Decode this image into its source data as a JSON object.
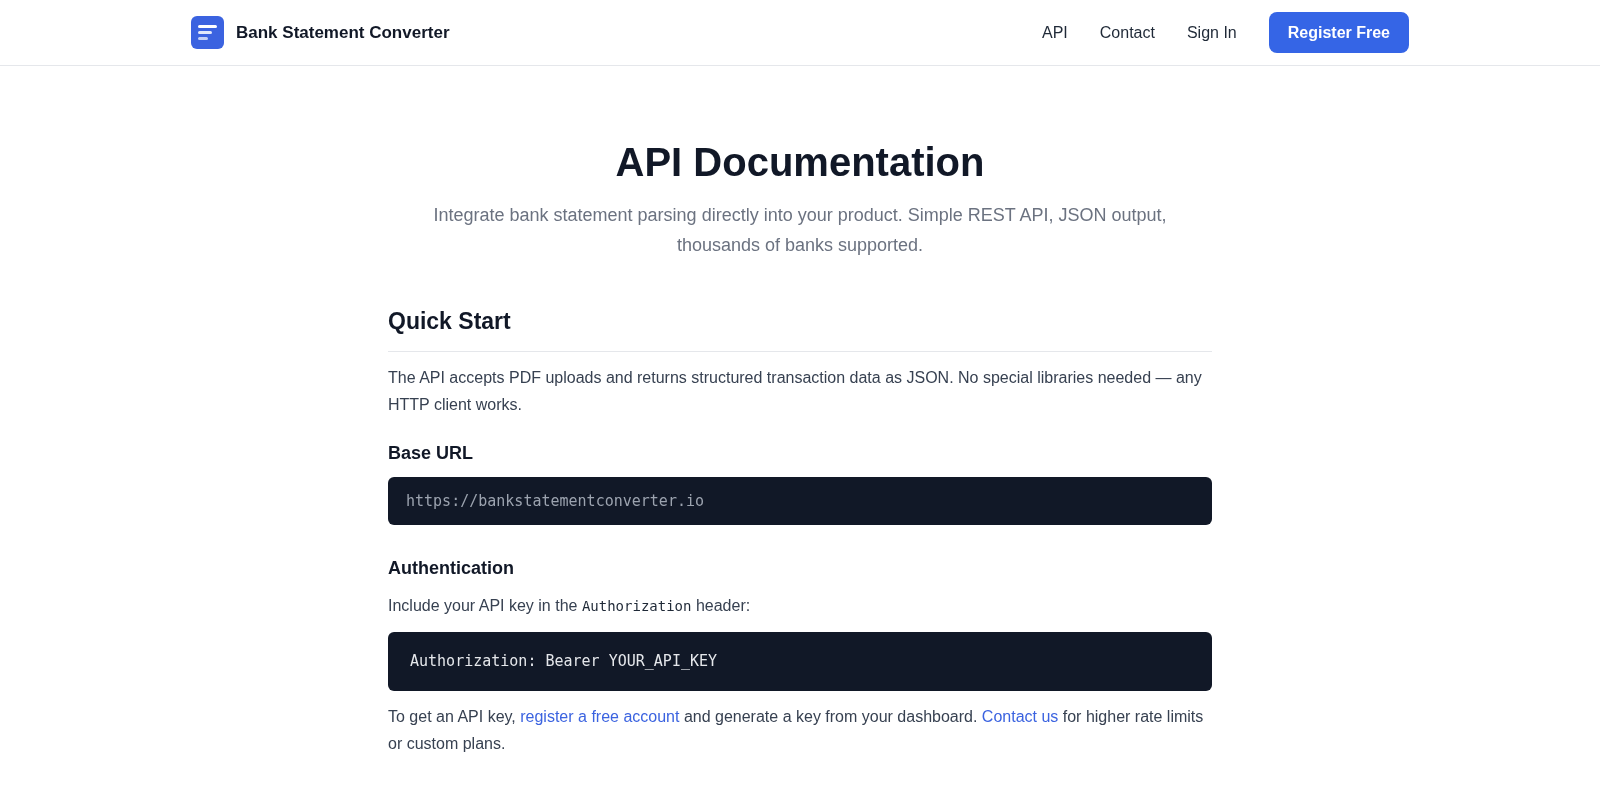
{
  "header": {
    "brand": "Bank Statement Converter",
    "nav": [
      "API",
      "Contact",
      "Sign In"
    ],
    "cta": "Register Free"
  },
  "hero": {
    "title": "API Documentation",
    "subtitle": "Integrate bank statement parsing directly into your product. Simple REST API, JSON output, thousands of banks supported."
  },
  "section": {
    "title": "Quick Start",
    "intro": "The API accepts PDF uploads and returns structured transaction data as JSON. No special libraries needed — any HTTP client works.",
    "blocks": [
      {
        "kind": "code",
        "heading": "Base URL",
        "code": "https://bankstatementconverter.io",
        "muted": true
      },
      {
        "kind": "code",
        "heading": "Authentication",
        "note": [
          {
            "kind": "text",
            "text": "Include your API key in the "
          },
          {
            "kind": "code",
            "text": "Authorization"
          },
          {
            "kind": "text",
            "text": " header:"
          }
        ],
        "code": "Authorization: Bearer YOUR_API_KEY",
        "muted": false
      }
    ],
    "footer_note": [
      {
        "kind": "text",
        "text": "To get an API key, "
      },
      {
        "kind": "link",
        "text": "register a free account"
      },
      {
        "kind": "text",
        "text": " and generate a key from your dashboard. "
      },
      {
        "kind": "link",
        "text": "Contact us"
      },
      {
        "kind": "text",
        "text": " for higher rate limits or custom plans."
      }
    ]
  }
}
